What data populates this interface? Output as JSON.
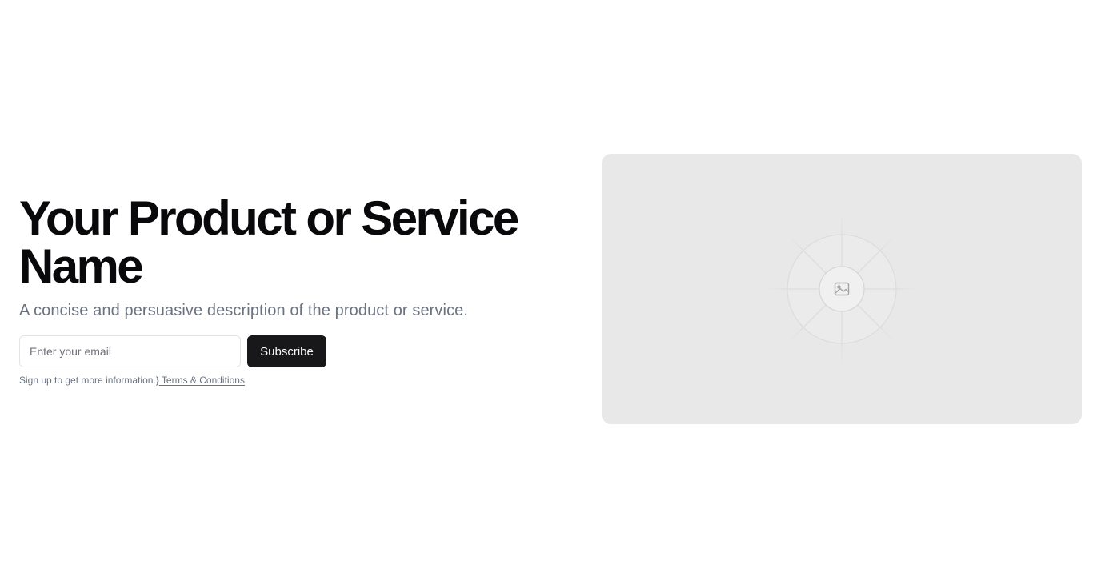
{
  "hero": {
    "title": "Your Product or Service Name",
    "description": "A concise and persuasive description of the product or service.",
    "email_placeholder": "Enter your email",
    "subscribe_label": "Subscribe",
    "note_text": "Sign up to get more information.}",
    "terms_link": " Terms & Conditions"
  },
  "image_placeholder": {
    "icon": "image-icon",
    "background_color": "#e8e8e8"
  },
  "colors": {
    "heading": "#09090b",
    "muted": "#6b7280",
    "button_bg": "#18181b",
    "button_text": "#fafafa",
    "border": "#e4e4e7"
  }
}
